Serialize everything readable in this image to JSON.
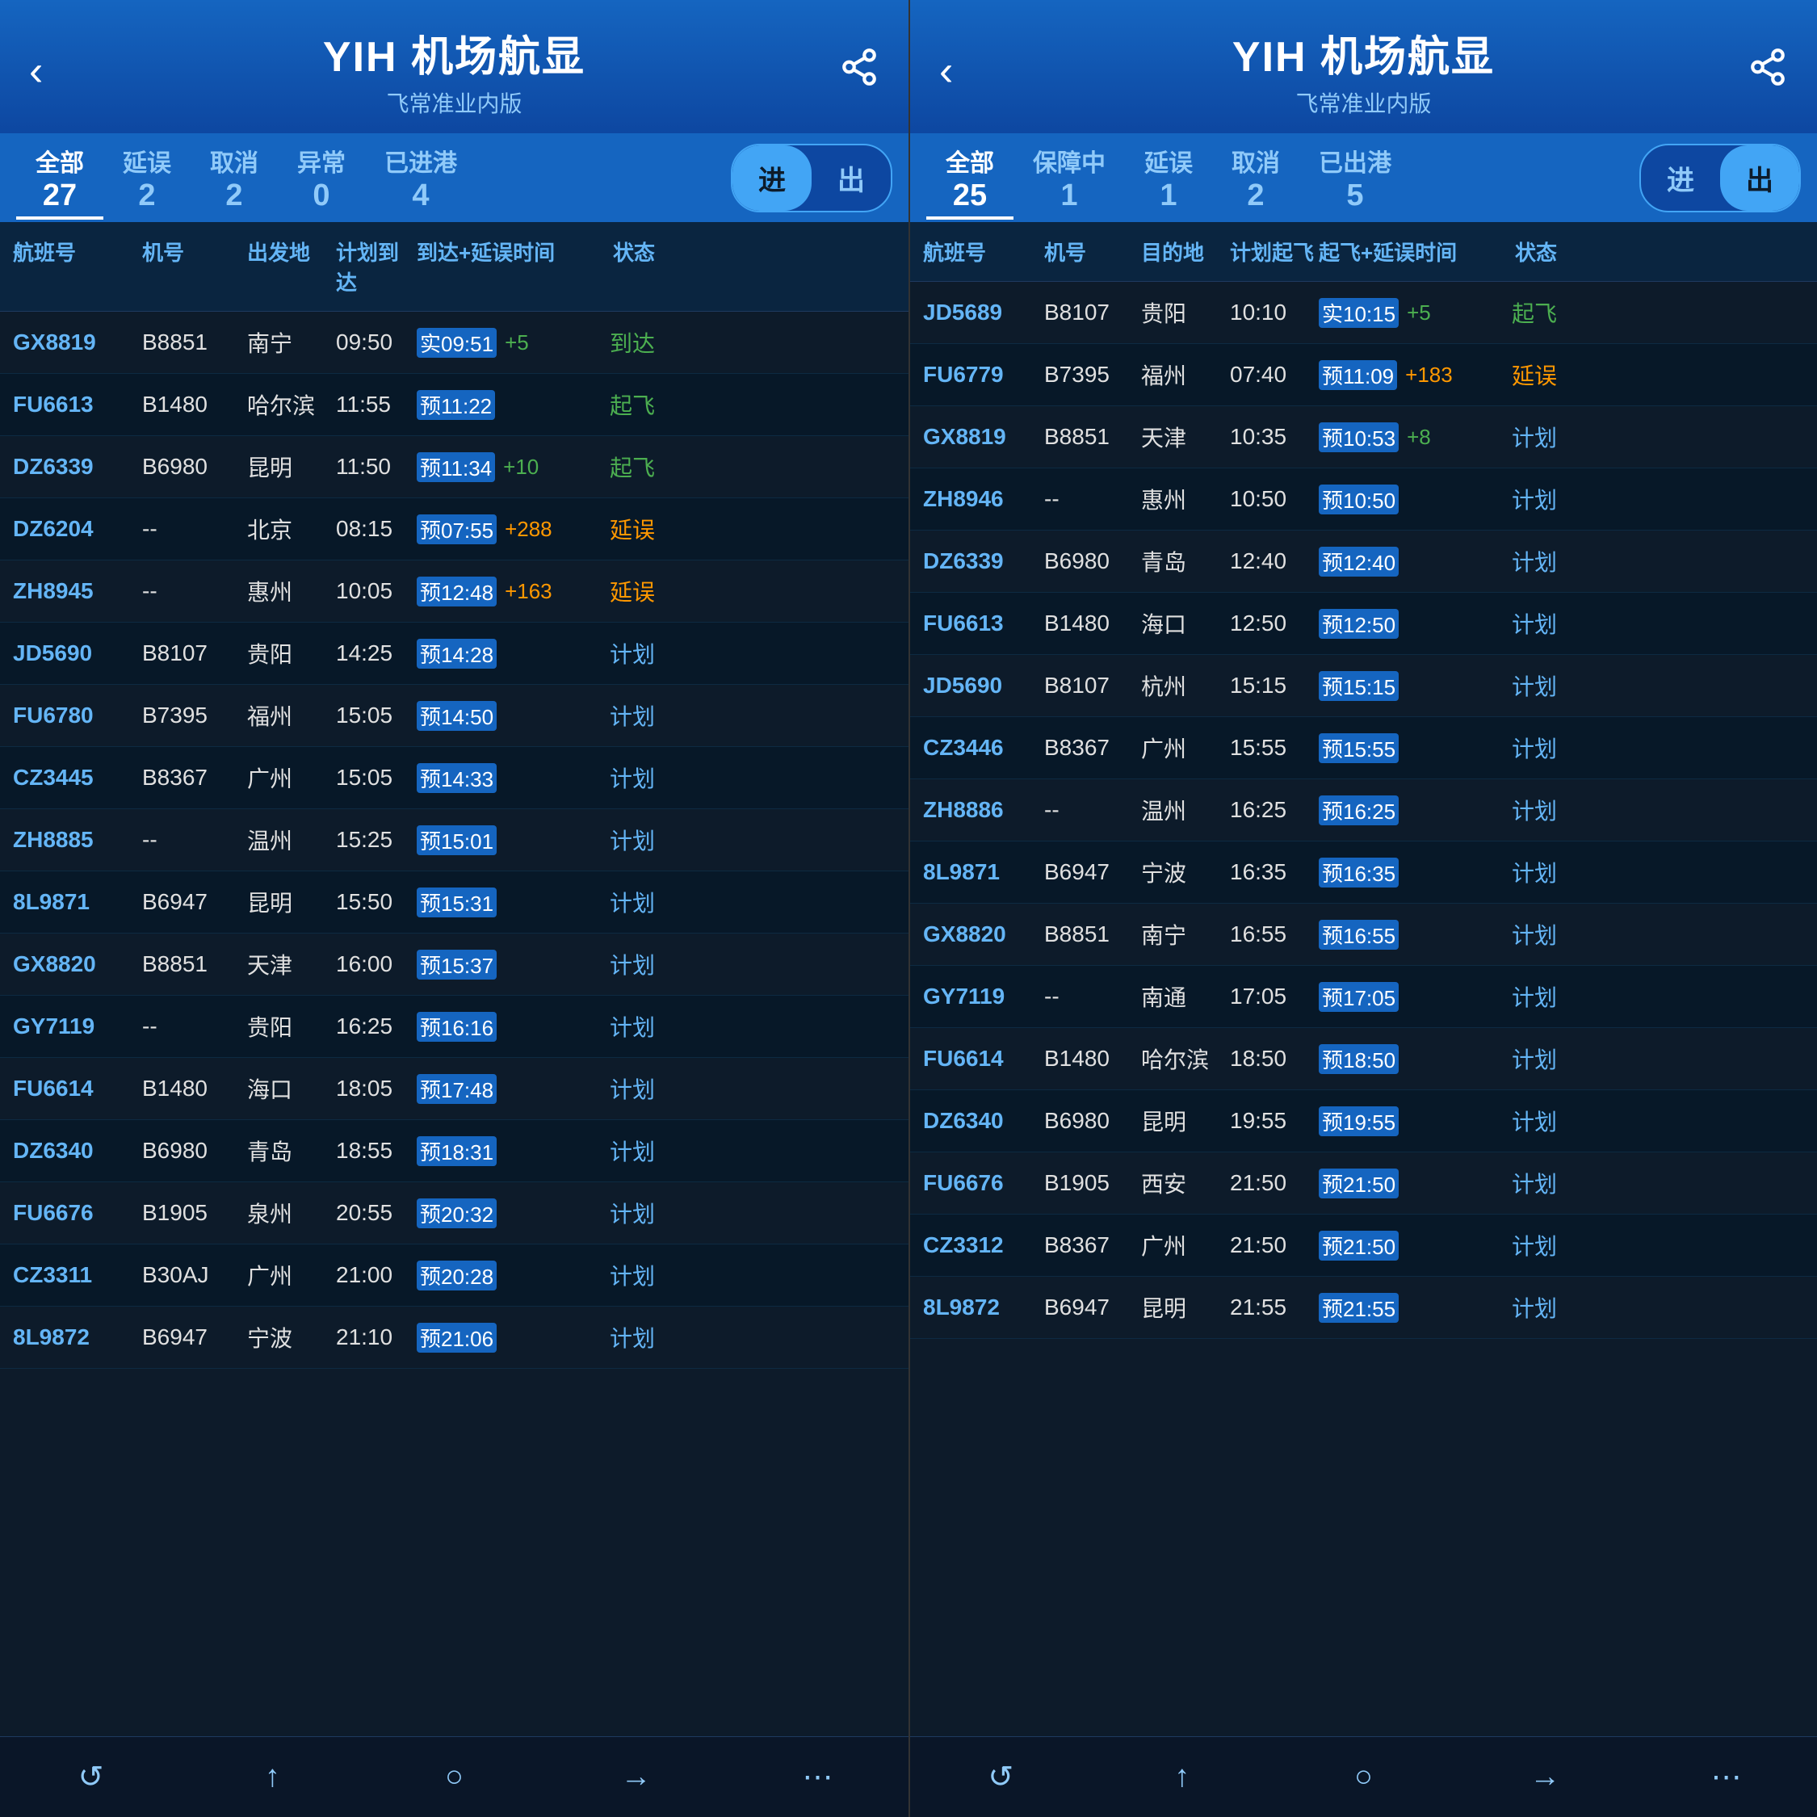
{
  "panels": [
    {
      "id": "arrival",
      "header": {
        "title": "YIH 机场航显",
        "subtitle": "飞常准业内版",
        "back_icon": "‹",
        "share_icon": "⎙"
      },
      "tabs": [
        {
          "label": "全部",
          "count": "27",
          "active": true
        },
        {
          "label": "延误",
          "count": "2"
        },
        {
          "label": "取消",
          "count": "2"
        },
        {
          "label": "异常",
          "count": "0"
        },
        {
          "label": "已进港",
          "count": "4"
        }
      ],
      "toggle": {
        "options": [
          "进",
          "出"
        ],
        "active": "进"
      },
      "table_headers": [
        "航班号",
        "机号",
        "出发地",
        "计划到达",
        "到达+延误时间",
        "状态"
      ],
      "rows": [
        {
          "flight": "GX8819",
          "plane": "B8851",
          "origin": "南宁",
          "plan": "09:50",
          "pred_prefix": "实",
          "predicted": "09:51",
          "delta": "+5",
          "delta_color": "pos",
          "status": "到达",
          "status_color": "arrive"
        },
        {
          "flight": "FU6613",
          "plane": "B1480",
          "origin": "哈尔滨",
          "plan": "11:55",
          "pred_prefix": "预",
          "predicted": "11:22",
          "delta": "",
          "delta_color": "",
          "status": "起飞",
          "status_color": "takeoff"
        },
        {
          "flight": "DZ6339",
          "plane": "B6980",
          "origin": "昆明",
          "plan": "11:50",
          "pred_prefix": "预",
          "predicted": "11:34",
          "delta": "+10",
          "delta_color": "pos",
          "status": "起飞",
          "status_color": "takeoff"
        },
        {
          "flight": "DZ6204",
          "plane": "--",
          "origin": "北京",
          "plan": "08:15",
          "pred_prefix": "预",
          "predicted": "07:55",
          "delta": "+288",
          "delta_color": "orange",
          "status": "延误",
          "status_color": "delay"
        },
        {
          "flight": "ZH8945",
          "plane": "--",
          "origin": "惠州",
          "plan": "10:05",
          "pred_prefix": "预",
          "predicted": "12:48",
          "delta": "+163",
          "delta_color": "orange",
          "status": "延误",
          "status_color": "delay"
        },
        {
          "flight": "JD5690",
          "plane": "B8107",
          "origin": "贵阳",
          "plan": "14:25",
          "pred_prefix": "预",
          "predicted": "14:28",
          "delta": "",
          "delta_color": "",
          "status": "计划",
          "status_color": "plan"
        },
        {
          "flight": "FU6780",
          "plane": "B7395",
          "origin": "福州",
          "plan": "15:05",
          "pred_prefix": "预",
          "predicted": "14:50",
          "delta": "",
          "delta_color": "",
          "status": "计划",
          "status_color": "plan"
        },
        {
          "flight": "CZ3445",
          "plane": "B8367",
          "origin": "广州",
          "plan": "15:05",
          "pred_prefix": "预",
          "predicted": "14:33",
          "delta": "",
          "delta_color": "",
          "status": "计划",
          "status_color": "plan"
        },
        {
          "flight": "ZH8885",
          "plane": "--",
          "origin": "温州",
          "plan": "15:25",
          "pred_prefix": "预",
          "predicted": "15:01",
          "delta": "",
          "delta_color": "",
          "status": "计划",
          "status_color": "plan"
        },
        {
          "flight": "8L9871",
          "plane": "B6947",
          "origin": "昆明",
          "plan": "15:50",
          "pred_prefix": "预",
          "predicted": "15:31",
          "delta": "",
          "delta_color": "",
          "status": "计划",
          "status_color": "plan"
        },
        {
          "flight": "GX8820",
          "plane": "B8851",
          "origin": "天津",
          "plan": "16:00",
          "pred_prefix": "预",
          "predicted": "15:37",
          "delta": "",
          "delta_color": "",
          "status": "计划",
          "status_color": "plan"
        },
        {
          "flight": "GY7119",
          "plane": "--",
          "origin": "贵阳",
          "plan": "16:25",
          "pred_prefix": "预",
          "predicted": "16:16",
          "delta": "",
          "delta_color": "",
          "status": "计划",
          "status_color": "plan"
        },
        {
          "flight": "FU6614",
          "plane": "B1480",
          "origin": "海口",
          "plan": "18:05",
          "pred_prefix": "预",
          "predicted": "17:48",
          "delta": "",
          "delta_color": "",
          "status": "计划",
          "status_color": "plan"
        },
        {
          "flight": "DZ6340",
          "plane": "B6980",
          "origin": "青岛",
          "plan": "18:55",
          "pred_prefix": "预",
          "predicted": "18:31",
          "delta": "",
          "delta_color": "",
          "status": "计划",
          "status_color": "plan"
        },
        {
          "flight": "FU6676",
          "plane": "B1905",
          "origin": "泉州",
          "plan": "20:55",
          "pred_prefix": "预",
          "predicted": "20:32",
          "delta": "",
          "delta_color": "",
          "status": "计划",
          "status_color": "plan"
        },
        {
          "flight": "CZ3311",
          "plane": "B30AJ",
          "origin": "广州",
          "plan": "21:00",
          "pred_prefix": "预",
          "predicted": "20:28",
          "delta": "",
          "delta_color": "",
          "status": "计划",
          "status_color": "plan"
        },
        {
          "flight": "8L9872",
          "plane": "B6947",
          "origin": "宁波",
          "plan": "21:10",
          "pred_prefix": "预",
          "predicted": "21:06",
          "delta": "",
          "delta_color": "",
          "status": "计划",
          "status_color": "plan"
        }
      ],
      "bottom_icons": [
        "↺",
        "↑",
        "○",
        "→",
        "⋯"
      ]
    },
    {
      "id": "departure",
      "header": {
        "title": "YIH 机场航显",
        "subtitle": "飞常准业内版",
        "back_icon": "‹",
        "share_icon": "⎙"
      },
      "tabs": [
        {
          "label": "全部",
          "count": "25",
          "active": true
        },
        {
          "label": "保障中",
          "count": "1"
        },
        {
          "label": "延误",
          "count": "1"
        },
        {
          "label": "取消",
          "count": "2"
        },
        {
          "label": "已出港",
          "count": "5"
        }
      ],
      "toggle": {
        "options": [
          "进",
          "出"
        ],
        "active": "出"
      },
      "table_headers": [
        "航班号",
        "机号",
        "目的地",
        "计划起飞",
        "起飞+延误时间",
        "状态"
      ],
      "rows": [
        {
          "flight": "JD5689",
          "plane": "B8107",
          "dest": "贵阳",
          "plan": "10:10",
          "pred_prefix": "实",
          "predicted": "10:15",
          "delta": "+5",
          "delta_color": "pos",
          "status": "起飞",
          "status_color": "takeoff"
        },
        {
          "flight": "FU6779",
          "plane": "B7395",
          "dest": "福州",
          "plan": "07:40",
          "pred_prefix": "预",
          "predicted": "11:09",
          "delta": "+183",
          "delta_color": "orange",
          "status": "延误",
          "status_color": "delay"
        },
        {
          "flight": "GX8819",
          "plane": "B8851",
          "dest": "天津",
          "plan": "10:35",
          "pred_prefix": "预",
          "predicted": "10:53",
          "delta": "+8",
          "delta_color": "pos",
          "status": "计划",
          "status_color": "plan"
        },
        {
          "flight": "ZH8946",
          "plane": "--",
          "dest": "惠州",
          "plan": "10:50",
          "pred_prefix": "预",
          "predicted": "10:50",
          "delta": "",
          "delta_color": "",
          "status": "计划",
          "status_color": "plan"
        },
        {
          "flight": "DZ6339",
          "plane": "B6980",
          "dest": "青岛",
          "plan": "12:40",
          "pred_prefix": "预",
          "predicted": "12:40",
          "delta": "",
          "delta_color": "",
          "status": "计划",
          "status_color": "plan"
        },
        {
          "flight": "FU6613",
          "plane": "B1480",
          "dest": "海口",
          "plan": "12:50",
          "pred_prefix": "预",
          "predicted": "12:50",
          "delta": "",
          "delta_color": "",
          "status": "计划",
          "status_color": "plan"
        },
        {
          "flight": "JD5690",
          "plane": "B8107",
          "dest": "杭州",
          "plan": "15:15",
          "pred_prefix": "预",
          "predicted": "15:15",
          "delta": "",
          "delta_color": "",
          "status": "计划",
          "status_color": "plan"
        },
        {
          "flight": "CZ3446",
          "plane": "B8367",
          "dest": "广州",
          "plan": "15:55",
          "pred_prefix": "预",
          "predicted": "15:55",
          "delta": "",
          "delta_color": "",
          "status": "计划",
          "status_color": "plan"
        },
        {
          "flight": "ZH8886",
          "plane": "--",
          "dest": "温州",
          "plan": "16:25",
          "pred_prefix": "预",
          "predicted": "16:25",
          "delta": "",
          "delta_color": "",
          "status": "计划",
          "status_color": "plan"
        },
        {
          "flight": "8L9871",
          "plane": "B6947",
          "dest": "宁波",
          "plan": "16:35",
          "pred_prefix": "预",
          "predicted": "16:35",
          "delta": "",
          "delta_color": "",
          "status": "计划",
          "status_color": "plan"
        },
        {
          "flight": "GX8820",
          "plane": "B8851",
          "dest": "南宁",
          "plan": "16:55",
          "pred_prefix": "预",
          "predicted": "16:55",
          "delta": "",
          "delta_color": "",
          "status": "计划",
          "status_color": "plan"
        },
        {
          "flight": "GY7119",
          "plane": "--",
          "dest": "南通",
          "plan": "17:05",
          "pred_prefix": "预",
          "predicted": "17:05",
          "delta": "",
          "delta_color": "",
          "status": "计划",
          "status_color": "plan"
        },
        {
          "flight": "FU6614",
          "plane": "B1480",
          "dest": "哈尔滨",
          "plan": "18:50",
          "pred_prefix": "预",
          "predicted": "18:50",
          "delta": "",
          "delta_color": "",
          "status": "计划",
          "status_color": "plan"
        },
        {
          "flight": "DZ6340",
          "plane": "B6980",
          "dest": "昆明",
          "plan": "19:55",
          "pred_prefix": "预",
          "predicted": "19:55",
          "delta": "",
          "delta_color": "",
          "status": "计划",
          "status_color": "plan"
        },
        {
          "flight": "FU6676",
          "plane": "B1905",
          "dest": "西安",
          "plan": "21:50",
          "pred_prefix": "预",
          "predicted": "21:50",
          "delta": "",
          "delta_color": "",
          "status": "计划",
          "status_color": "plan"
        },
        {
          "flight": "CZ3312",
          "plane": "B8367",
          "dest": "广州",
          "plan": "21:50",
          "pred_prefix": "预",
          "predicted": "21:50",
          "delta": "",
          "delta_color": "",
          "status": "计划",
          "status_color": "plan"
        },
        {
          "flight": "8L9872",
          "plane": "B6947",
          "dest": "昆明",
          "plan": "21:55",
          "pred_prefix": "预",
          "predicted": "21:55",
          "delta": "",
          "delta_color": "",
          "status": "计划",
          "status_color": "plan"
        }
      ],
      "bottom_icons": [
        "↺",
        "↑",
        "○",
        "→",
        "⋯"
      ]
    }
  ]
}
